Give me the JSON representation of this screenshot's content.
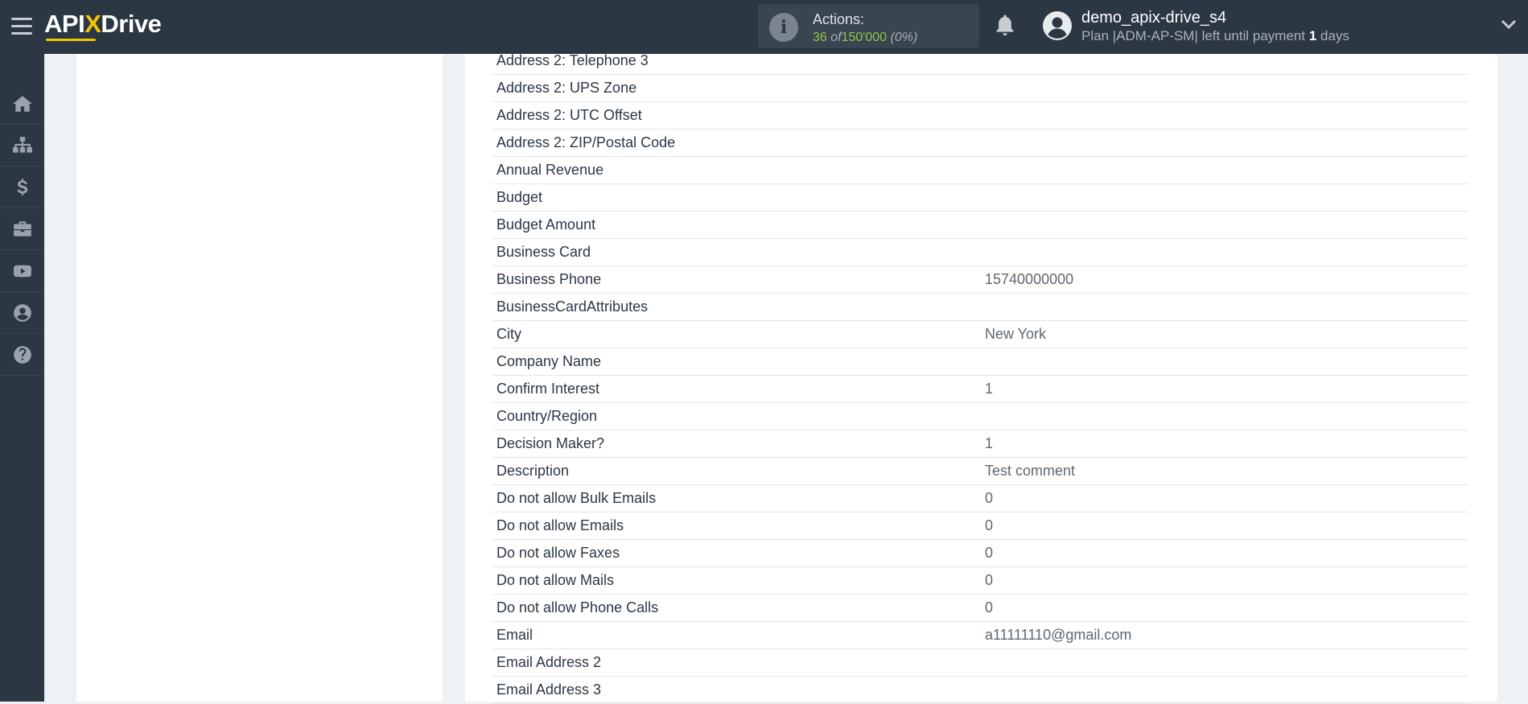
{
  "header": {
    "logo_prefix": "API",
    "logo_x": "X",
    "logo_suffix": "Drive",
    "actions_label": "Actions:",
    "actions_used": "36",
    "actions_of": "of",
    "actions_total": "150'000",
    "actions_percent": "(0%)",
    "username": "demo_apix-drive_s4",
    "plan_text": "Plan |ADM-AP-SM| left until payment",
    "plan_days": "1",
    "plan_days_unit": "days"
  },
  "sidebar": {
    "items": [
      {
        "icon": "home-icon"
      },
      {
        "icon": "sitemap-icon"
      },
      {
        "icon": "dollar-icon"
      },
      {
        "icon": "briefcase-icon"
      },
      {
        "icon": "youtube-icon"
      },
      {
        "icon": "user-circle-icon"
      },
      {
        "icon": "help-icon"
      }
    ]
  },
  "fields": {
    "rows": [
      {
        "label": "Address 2: Telephone 3",
        "value": ""
      },
      {
        "label": "Address 2: UPS Zone",
        "value": ""
      },
      {
        "label": "Address 2: UTC Offset",
        "value": ""
      },
      {
        "label": "Address 2: ZIP/Postal Code",
        "value": ""
      },
      {
        "label": "Annual Revenue",
        "value": ""
      },
      {
        "label": "Budget",
        "value": ""
      },
      {
        "label": "Budget Amount",
        "value": ""
      },
      {
        "label": "Business Card",
        "value": ""
      },
      {
        "label": "Business Phone",
        "value": "15740000000"
      },
      {
        "label": "BusinessCardAttributes",
        "value": ""
      },
      {
        "label": "City",
        "value": "New York"
      },
      {
        "label": "Company Name",
        "value": ""
      },
      {
        "label": "Confirm Interest",
        "value": "1"
      },
      {
        "label": "Country/Region",
        "value": ""
      },
      {
        "label": "Decision Maker?",
        "value": "1"
      },
      {
        "label": "Description",
        "value": "Test comment"
      },
      {
        "label": "Do not allow Bulk Emails",
        "value": "0"
      },
      {
        "label": "Do not allow Emails",
        "value": "0"
      },
      {
        "label": "Do not allow Faxes",
        "value": "0"
      },
      {
        "label": "Do not allow Mails",
        "value": "0"
      },
      {
        "label": "Do not allow Phone Calls",
        "value": "0"
      },
      {
        "label": "Email",
        "value": "a11111110@gmail.com"
      },
      {
        "label": "Email Address 2",
        "value": ""
      },
      {
        "label": "Email Address 3",
        "value": ""
      }
    ]
  }
}
